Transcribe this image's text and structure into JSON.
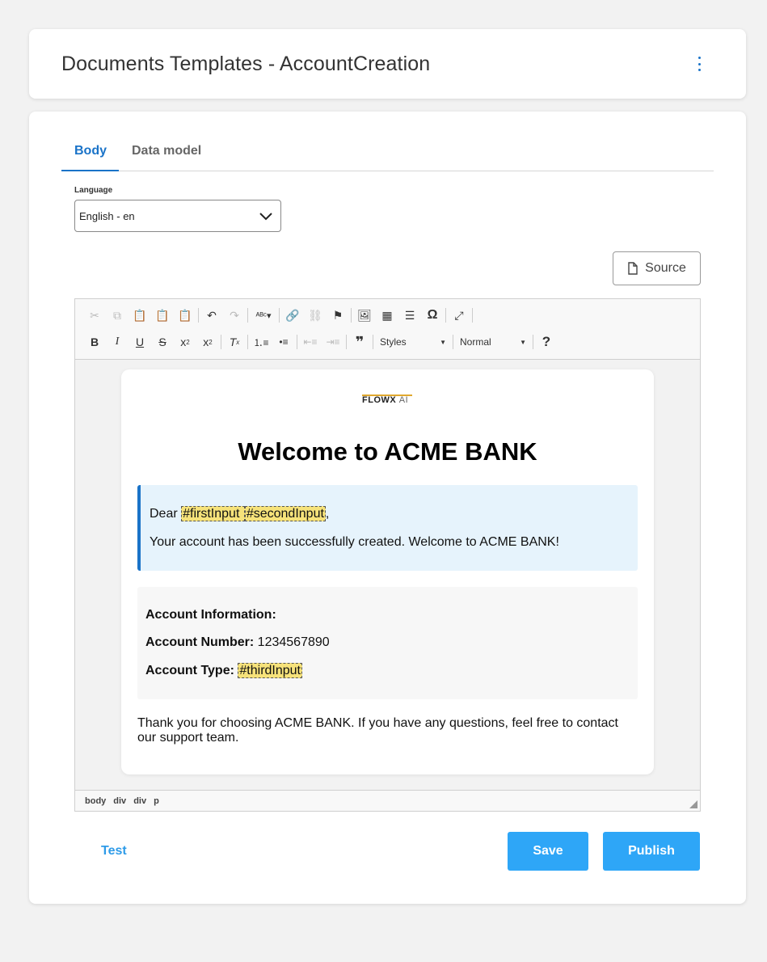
{
  "header": {
    "title": "Documents Templates - AccountCreation"
  },
  "tabs": [
    {
      "label": "Body",
      "active": true
    },
    {
      "label": "Data model",
      "active": false
    }
  ],
  "language": {
    "label": "Language",
    "value": "English - en"
  },
  "source_button": {
    "label": "Source"
  },
  "toolbar": {
    "styles_label": "Styles",
    "format_label": "Normal",
    "help_label": "?"
  },
  "document": {
    "logo_main": "FLOWX",
    "logo_suffix": "AI",
    "heading": "Welcome to ACME BANK",
    "greeting_prefix": "Dear ",
    "placeholder_first": "#firstInput ",
    "placeholder_second": "#secondInput",
    "greeting_suffix": ",",
    "message": "Your account has been successfully created. Welcome to ACME BANK!",
    "info_title": "Account Information:",
    "account_number_label": "Account Number:",
    "account_number_value": " 1234567890",
    "account_type_label": "Account Type:",
    "placeholder_third": "#thirdInput",
    "thanks": "Thank you for choosing ACME BANK. If you have any questions, feel free to contact our support team."
  },
  "path": [
    "body",
    "div",
    "div",
    "p"
  ],
  "actions": {
    "test_label": "Test",
    "save_label": "Save",
    "publish_label": "Publish"
  },
  "colors": {
    "accent": "#1a73c8",
    "button": "#2ea6f7",
    "placeholder_bg": "#f6e27a",
    "greeting_bg": "#e6f3fc"
  }
}
